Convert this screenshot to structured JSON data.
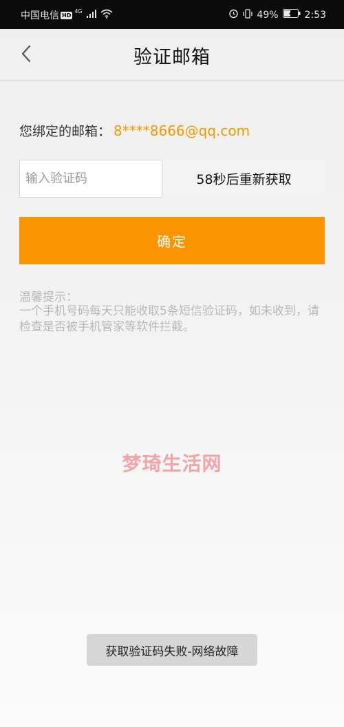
{
  "status_bar": {
    "carrier": "中国电信",
    "hd_badge": "HD",
    "network": "4G",
    "battery": "49%",
    "time": "2:53"
  },
  "header": {
    "title": "验证邮箱",
    "back_icon": "chevron-left-icon"
  },
  "email": {
    "label": "您绑定的邮箱：",
    "value": "8****8666@qq.com"
  },
  "code_input": {
    "placeholder": "输入验证码",
    "value": ""
  },
  "resend": {
    "label": "58秒后重新获取"
  },
  "confirm": {
    "label": "确定"
  },
  "tips": {
    "title": "温馨提示：",
    "body": "一个手机号码每天只能收取5条短信验证码，如未收到，请检查是否被手机管家等软件拦截。"
  },
  "watermark": "梦琦生活网",
  "toast": "获取验证码失败-网络故障",
  "colors": {
    "accent": "#fc9300",
    "email_text": "#f29800",
    "watermark": "#f2a4a8"
  }
}
